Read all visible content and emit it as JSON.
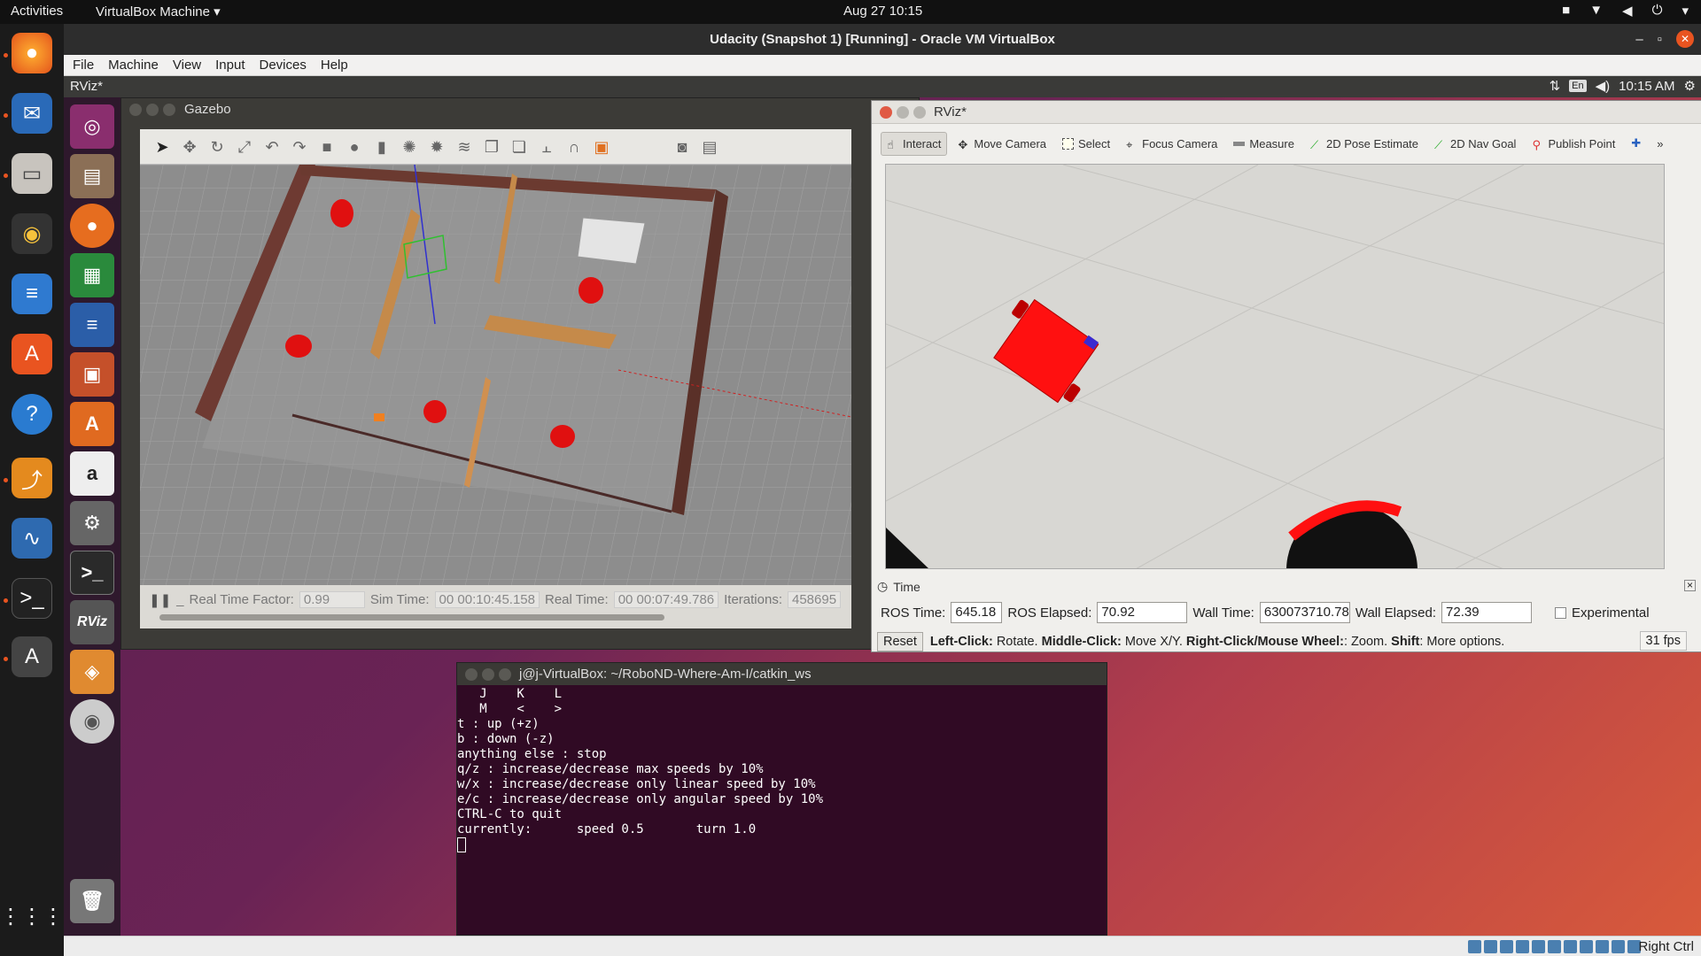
{
  "topbar": {
    "activities": "Activities",
    "app_menu": "VirtualBox Machine ▾",
    "clock": "Aug 27  10:15"
  },
  "vbox": {
    "title": "Udacity (Snapshot 1) [Running] - Oracle VM VirtualBox",
    "menu": [
      "File",
      "Machine",
      "View",
      "Input",
      "Devices",
      "Help"
    ],
    "host_key": "Right Ctrl"
  },
  "guest_top": {
    "title": "RViz*",
    "lang": "En",
    "time": "10:15 AM"
  },
  "gazebo": {
    "title": "Gazebo",
    "rtf_label": "Real Time Factor:",
    "rtf": "0.99",
    "sim_label": "Sim Time:",
    "sim": "00 00:10:45.158",
    "real_label": "Real Time:",
    "real": "00 00:07:49.786",
    "iter_label": "Iterations:",
    "iter": "458695"
  },
  "rviz": {
    "title": "RViz*",
    "tools": [
      "Interact",
      "Move Camera",
      "Select",
      "Focus Camera",
      "Measure",
      "2D Pose Estimate",
      "2D Nav Goal",
      "Publish Point"
    ],
    "time_panel": "Time",
    "ros_time_label": "ROS Time:",
    "ros_time": "645.18",
    "ros_elapsed_label": "ROS Elapsed:",
    "ros_elapsed": "70.92",
    "wall_time_label": "Wall Time:",
    "wall_time": "630073710.78",
    "wall_elapsed_label": "Wall Elapsed:",
    "wall_elapsed": "72.39",
    "experimental": "Experimental",
    "reset": "Reset",
    "hint_b1": "Left-Click:",
    "hint_t1": " Rotate. ",
    "hint_b2": "Middle-Click:",
    "hint_t2": " Move X/Y. ",
    "hint_b3": "Right-Click/Mouse Wheel:",
    "hint_t3": ": Zoom. ",
    "hint_b4": "Shift",
    "hint_t4": ": More options.",
    "fps": "31 fps"
  },
  "terminal": {
    "title": "j@j-VirtualBox: ~/RoboND-Where-Am-I/catkin_ws",
    "lines": [
      "   J    K    L",
      "   M    <    >",
      "",
      "t : up (+z)",
      "b : down (-z)",
      "",
      "anything else : stop",
      "",
      "q/z : increase/decrease max speeds by 10%",
      "w/x : increase/decrease only linear speed by 10%",
      "e/c : increase/decrease only angular speed by 10%",
      "",
      "CTRL-C to quit",
      "",
      "currently:      speed 0.5       turn 1.0"
    ]
  }
}
